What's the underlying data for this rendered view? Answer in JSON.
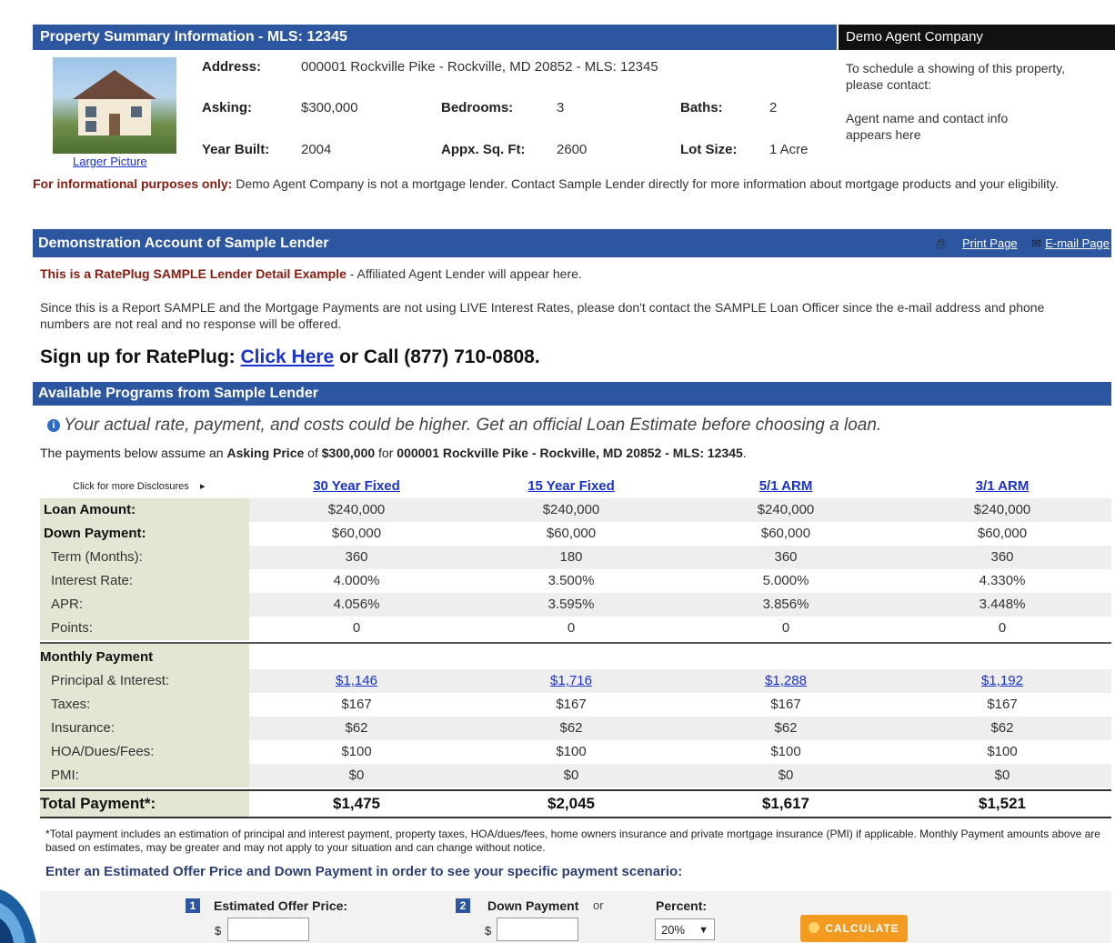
{
  "header": {
    "title": "Property Summary Information - MLS: 12345",
    "company": "Demo Agent Company"
  },
  "property": {
    "larger_picture": "Larger Picture",
    "address_label": "Address:",
    "address_value": "000001 Rockville Pike - Rockville, MD 20852 - MLS: 12345",
    "asking_label": "Asking:",
    "asking_value": "$300,000",
    "bedrooms_label": "Bedrooms:",
    "bedrooms_value": "3",
    "baths_label": "Baths:",
    "baths_value": "2",
    "year_label": "Year Built:",
    "year_value": "2004",
    "sqft_label": "Appx. Sq. Ft:",
    "sqft_value": "2600",
    "lot_label": "Lot Size:",
    "lot_value": "1 Acre",
    "schedule_text": "To schedule a showing of this property, please contact:",
    "agent_text": "Agent name and contact info appears here"
  },
  "disclaimer": {
    "bold": "For informational purposes only:",
    "text": " Demo Agent Company is not a mortgage lender. Contact Sample Lender directly for more information about mortgage products and your eligibility."
  },
  "lender": {
    "title": "Demonstration Account of Sample Lender",
    "print": "Print Page",
    "email": "E-mail Page",
    "example_bold": "This is a RatePlug SAMPLE Lender Detail Example",
    "example_text": " - Affiliated Agent Lender will appear here.",
    "note": "Since this is a Report SAMPLE and the Mortgage Payments are not using LIVE Interest Rates, please don't contact the SAMPLE Loan Officer since the e-mail address and phone numbers are not real and no response will be offered.",
    "signup_prefix": "Sign up for RatePlug: ",
    "signup_link": "Click Here",
    "signup_suffix": " or Call (877) 710-0808."
  },
  "programs": {
    "title": "Available Programs from Sample Lender",
    "estimate_note": "Your actual rate, payment, and costs could be higher. Get an official Loan Estimate before choosing a loan.",
    "assume_1": "The payments below assume an ",
    "assume_2": "Asking Price",
    "assume_3": " of ",
    "assume_4": "$300,000",
    "assume_5": " for ",
    "assume_6": "000001 Rockville Pike - Rockville, MD 20852 - MLS: 12345",
    "assume_7": ".",
    "click_disclosures": "Click for more Disclosures",
    "columns": [
      "30 Year Fixed",
      "15 Year Fixed",
      "5/1 ARM",
      "3/1 ARM"
    ],
    "rows": [
      {
        "label": "Loan Amount:",
        "values": [
          "$240,000",
          "$240,000",
          "$240,000",
          "$240,000"
        ]
      },
      {
        "label": "Down Payment:",
        "values": [
          "$60,000",
          "$60,000",
          "$60,000",
          "$60,000"
        ]
      },
      {
        "label": "Term (Months):",
        "values": [
          "360",
          "180",
          "360",
          "360"
        ]
      },
      {
        "label": "Interest Rate:",
        "values": [
          "4.000%",
          "3.500%",
          "5.000%",
          "4.330%"
        ]
      },
      {
        "label": "APR:",
        "values": [
          "4.056%",
          "3.595%",
          "3.856%",
          "3.448%"
        ]
      },
      {
        "label": "Points:",
        "values": [
          "0",
          "0",
          "0",
          "0"
        ]
      }
    ],
    "monthly_label": "Monthly Payment",
    "monthly_rows": [
      {
        "label": "Principal & Interest:",
        "values": [
          "$1,146",
          "$1,716",
          "$1,288",
          "$1,192"
        ]
      },
      {
        "label": "Taxes:",
        "values": [
          "$167",
          "$167",
          "$167",
          "$167"
        ]
      },
      {
        "label": "Insurance:",
        "values": [
          "$62",
          "$62",
          "$62",
          "$62"
        ]
      },
      {
        "label": "HOA/Dues/Fees:",
        "values": [
          "$100",
          "$100",
          "$100",
          "$100"
        ]
      },
      {
        "label": "PMI:",
        "values": [
          "$0",
          "$0",
          "$0",
          "$0"
        ]
      }
    ],
    "total_label": "Total Payment*:",
    "total_values": [
      "$1,475",
      "$2,045",
      "$1,617",
      "$1,521"
    ],
    "footnote": "*Total payment includes an estimation of principal and interest payment, property taxes, HOA/dues/fees, home owners insurance and private mortgage insurance (PMI) if applicable. Monthly Payment amounts above are based on estimates, may be greater and may not apply to your situation and can change without notice."
  },
  "calculator": {
    "heading": "Enter an Estimated Offer Price and Down Payment in order to see your specific payment scenario:",
    "step1": "1",
    "offer_label": "Estimated Offer Price:",
    "step2": "2",
    "down_label": "Down Payment",
    "or": "or",
    "percent_label": "Percent:",
    "currency": "$",
    "offer_value": "",
    "down_value": "",
    "percent_value": "20%",
    "calculate": "CALCULATE"
  },
  "colors": {
    "section_blue": "#2c56a0",
    "label_bg": "#e5e5d3",
    "calc_orange": "#f39b21",
    "disclaimer_red": "#8a1c10"
  }
}
